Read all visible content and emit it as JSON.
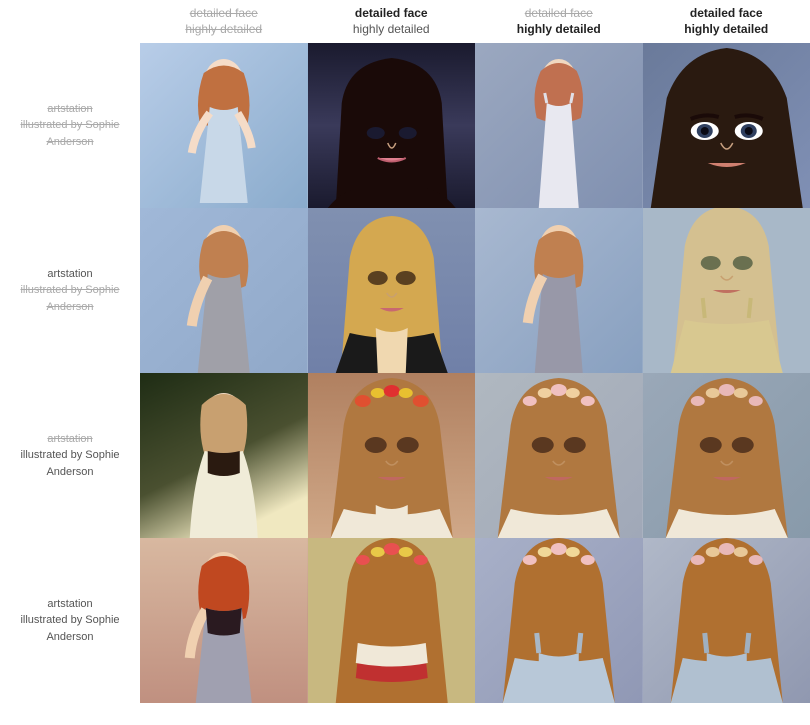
{
  "header": {
    "empty": "",
    "col1": {
      "line1": "detailed face",
      "line2": "highly detailed",
      "line1_strike": true,
      "line2_strike": true
    },
    "col2": {
      "line1": "detailed face",
      "line2": "highly detailed",
      "line1_strike": false,
      "line2_strike": false,
      "line1_bold": true,
      "line2_bold": false
    },
    "col3": {
      "line1": "detailed face",
      "line2": "highly detailed",
      "line1_strike": true,
      "line2_strike": false,
      "line2_bold": true
    },
    "col4": {
      "line1": "detailed face",
      "line2": "highly detailed",
      "line1_strike": false,
      "line2_strike": false,
      "line1_bold": true,
      "line2_bold": true
    }
  },
  "rows": [
    {
      "label_line1": "artstation",
      "label_line2": "illustrated by Sophie",
      "label_line3": "Anderson",
      "label_line1_strike": true,
      "label_line2_strike": true,
      "label_line3_strike": true
    },
    {
      "label_line1": "artstation",
      "label_line2": "illustrated by Sophie",
      "label_line3": "Anderson",
      "label_line1_strike": false,
      "label_line2_strike": true,
      "label_line3_strike": true
    },
    {
      "label_line1": "artstation",
      "label_line2": "illustrated by Sophie",
      "label_line3": "Anderson",
      "label_line1_strike": true,
      "label_line2_strike": false,
      "label_line3_strike": false
    },
    {
      "label_line1": "artstation",
      "label_line2": "illustrated by Sophie",
      "label_line3": "Anderson",
      "label_line1_strike": false,
      "label_line2_strike": false,
      "label_line3_strike": false
    }
  ]
}
